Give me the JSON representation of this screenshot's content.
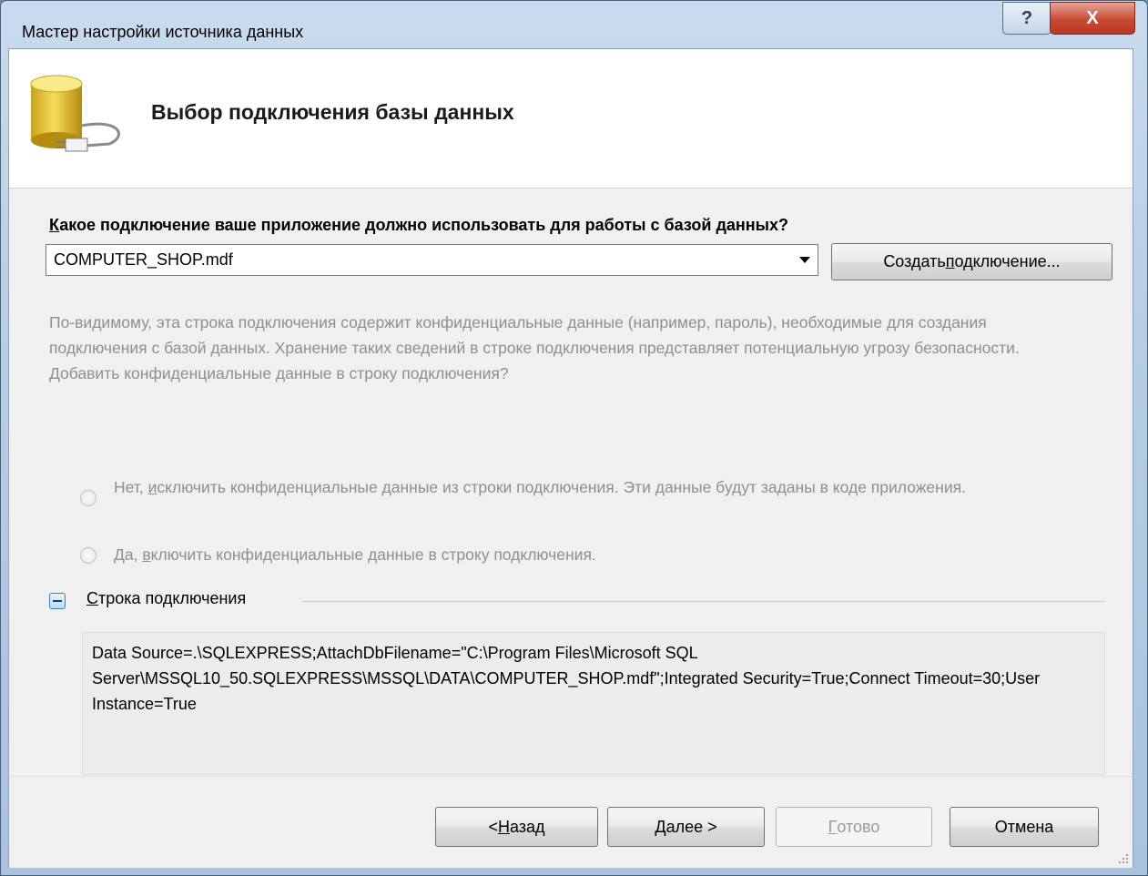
{
  "window": {
    "title": "Мастер настройки источника данных",
    "help_label": "?",
    "close_label": "X"
  },
  "header": {
    "title": "Выбор подключения базы данных",
    "icon": "database-plug-icon"
  },
  "connection": {
    "question_accel": "К",
    "question_rest": "акое подключение ваше приложение должно использовать для работы с базой данных?",
    "selected": "COMPUTER_SHOP.mdf",
    "new_button_pre": "Создать ",
    "new_button_accel": "п",
    "new_button_post": "одключение..."
  },
  "sensitive": {
    "warning": "По-видимому, эта строка подключения содержит конфиденциальные данные (например, пароль), необходимые для создания подключения с базой данных. Хранение таких сведений в строке подключения представляет потенциальную угрозу безопасности. Добавить конфиденциальные данные в строку подключения?",
    "option_no_pre": "Нет, ",
    "option_no_accel": "и",
    "option_no_post": "сключить конфиденциальные данные из строки подключения. Эти данные будут заданы в коде приложения.",
    "option_yes_pre": "Да, ",
    "option_yes_accel": "в",
    "option_yes_post": "ключить конфиденциальные данные в строку подключения."
  },
  "connection_string": {
    "label_accel": "С",
    "label_rest": "трока подключения",
    "value": "Data Source=.\\SQLEXPRESS;AttachDbFilename=\"C:\\Program Files\\Microsoft SQL Server\\MSSQL10_50.SQLEXPRESS\\MSSQL\\DATA\\COMPUTER_SHOP.mdf\";Integrated Security=True;Connect Timeout=30;User Instance=True"
  },
  "footer": {
    "back_pre": "< ",
    "back_accel": "Н",
    "back_post": "азад",
    "next_accel": "Д",
    "next_post": "алее >",
    "finish_accel": "Г",
    "finish_post": "отово",
    "cancel": "Отмена"
  }
}
